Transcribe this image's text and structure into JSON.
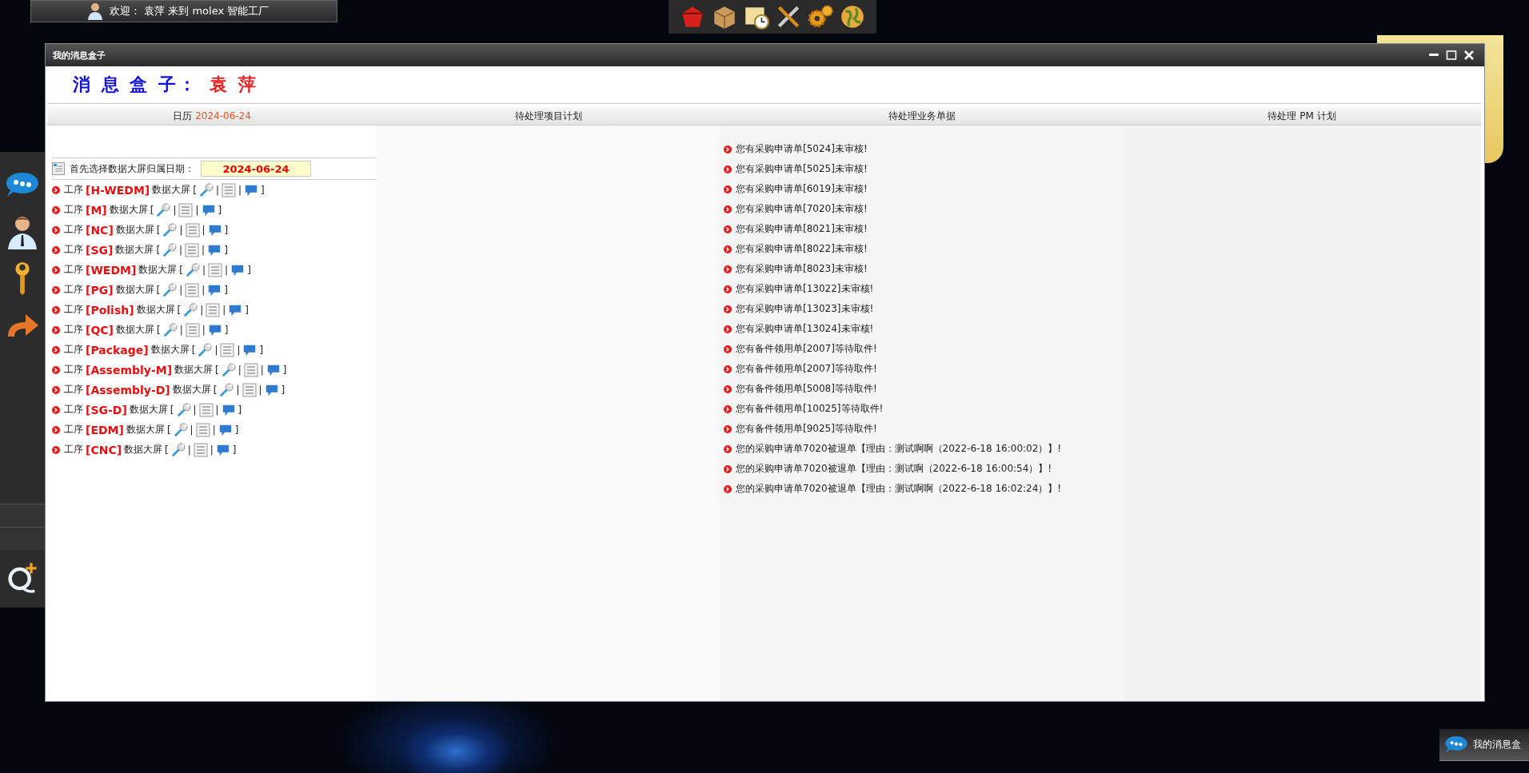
{
  "welcome_bar": {
    "text": "欢迎： 袁萍 来到 molex 智能工厂"
  },
  "window": {
    "title": "我的消息盒子"
  },
  "heading": {
    "label": "消 息 盒 子：",
    "name": "袁 萍"
  },
  "columns": [
    {
      "label": "日历",
      "date": "2024-06-24"
    },
    {
      "label": "待处理项目计划"
    },
    {
      "label": "待处理业务单据"
    },
    {
      "label": "待处理 PM 计划"
    }
  ],
  "date_picker": {
    "label": "首先选择数据大屏归属日期：",
    "value": "2024-06-24"
  },
  "processes": [
    {
      "prefix": "工序",
      "code": "[H-WEDM]",
      "label": "数据大屏",
      "open": "[",
      "sep1": "|",
      "sep2": "|",
      "close": "]"
    },
    {
      "prefix": "工序",
      "code": "[M]",
      "label": "数据大屏",
      "open": "[",
      "sep1": "|",
      "sep2": "|",
      "close": "]"
    },
    {
      "prefix": "工序",
      "code": "[NC]",
      "label": "数据大屏",
      "open": "[",
      "sep1": "|",
      "sep2": "|",
      "close": "]"
    },
    {
      "prefix": "工序",
      "code": "[SG]",
      "label": "数据大屏",
      "open": "[",
      "sep1": "|",
      "sep2": "|",
      "close": "]"
    },
    {
      "prefix": "工序",
      "code": "[WEDM]",
      "label": "数据大屏",
      "open": "[",
      "sep1": "|",
      "sep2": "|",
      "close": "]"
    },
    {
      "prefix": "工序",
      "code": "[PG]",
      "label": "数据大屏",
      "open": "[",
      "sep1": "|",
      "sep2": "|",
      "close": "]"
    },
    {
      "prefix": "工序",
      "code": "[Polish]",
      "label": "数据大屏",
      "open": "[",
      "sep1": "|",
      "sep2": "|",
      "close": "]"
    },
    {
      "prefix": "工序",
      "code": "[QC]",
      "label": "数据大屏",
      "open": "[",
      "sep1": "|",
      "sep2": "|",
      "close": "]"
    },
    {
      "prefix": "工序",
      "code": "[Package]",
      "label": "数据大屏",
      "open": "[",
      "sep1": "|",
      "sep2": "|",
      "close": "]"
    },
    {
      "prefix": "工序",
      "code": "[Assembly-M]",
      "label": "数据大屏",
      "open": "[",
      "sep1": "|",
      "sep2": "|",
      "close": "]"
    },
    {
      "prefix": "工序",
      "code": "[Assembly-D]",
      "label": "数据大屏",
      "open": "[",
      "sep1": "|",
      "sep2": "|",
      "close": "]"
    },
    {
      "prefix": "工序",
      "code": "[SG-D]",
      "label": "数据大屏",
      "open": "[",
      "sep1": "|",
      "sep2": "|",
      "close": "]"
    },
    {
      "prefix": "工序",
      "code": "[EDM]",
      "label": "数据大屏",
      "open": "[",
      "sep1": "|",
      "sep2": "|",
      "close": "]"
    },
    {
      "prefix": "工序",
      "code": "[CNC]",
      "label": "数据大屏",
      "open": "[",
      "sep1": "|",
      "sep2": "|",
      "close": "]"
    }
  ],
  "messages": [
    "您有采购申请单[5024]未审核!",
    "您有采购申请单[5025]未审核!",
    "您有采购申请单[6019]未审核!",
    "您有采购申请单[7020]未审核!",
    "您有采购申请单[8021]未审核!",
    "您有采购申请单[8022]未审核!",
    "您有采购申请单[8023]未审核!",
    "您有采购申请单[13022]未审核!",
    "您有采购申请单[13023]未审核!",
    "您有采购申请单[13024]未审核!",
    "您有备件领用单[2007]等待取件!",
    "您有备件领用单[2007]等待取件!",
    "您有备件领用单[5008]等待取件!",
    "您有备件领用单[10025]等待取件!",
    "您有备件领用单[9025]等待取件!",
    "您的采购申请单7020被退单【理由：测试啊啊（2022-6-18 16:00:02）】!",
    "您的采购申请单7020被退单【理由：测试啊（2022-6-18 16:00:54）】!",
    "您的采购申请单7020被退单【理由：测试啊啊（2022-6-18 16:02:24）】!"
  ],
  "dock": {
    "label": "我的消息盒"
  }
}
